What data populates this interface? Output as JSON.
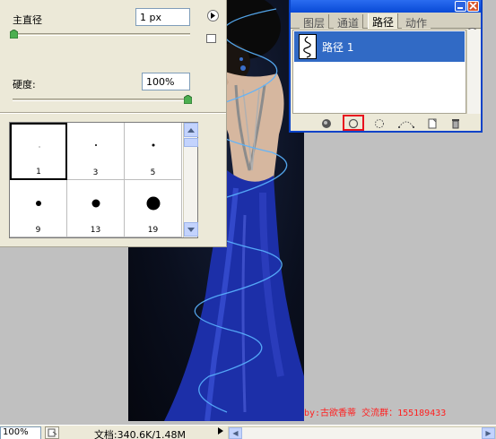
{
  "brush_panel": {
    "diameter_label": "主直径",
    "diameter_value": "1 px",
    "hardness_label": "硬度:",
    "hardness_value": "100%",
    "diameter_level": 0.0,
    "hardness_level": 1.0,
    "presets": [
      {
        "size": "1",
        "selected": true
      },
      {
        "size": "3",
        "selected": false
      },
      {
        "size": "5",
        "selected": false
      },
      {
        "size": "9",
        "selected": false
      },
      {
        "size": "13",
        "selected": false
      },
      {
        "size": "19",
        "selected": false
      }
    ]
  },
  "paths_palette": {
    "tabs": [
      {
        "label": "图层",
        "active": false
      },
      {
        "label": "通道",
        "active": false
      },
      {
        "label": "路径",
        "active": true
      },
      {
        "label": "动作",
        "active": false
      }
    ],
    "path_items": [
      {
        "label": "路径 1",
        "selected": true
      }
    ],
    "footer_icons": [
      "fill-path-icon",
      "stroke-path-icon",
      "load-as-selection-icon",
      "make-work-path-icon",
      "new-path-icon",
      "delete-path-icon"
    ],
    "highlight_color": "#e8111e"
  },
  "watermark": "by:古欲香蒂 交流群：155189433",
  "status_bar": {
    "zoom": "100%",
    "doc_info": "文档:340.6K/1.48M"
  },
  "colors": {
    "panel_bg": "#ece9d8",
    "title_blue": "#0849d6",
    "selection_blue": "#316ac5",
    "glow_line": "#5ab4ff"
  }
}
